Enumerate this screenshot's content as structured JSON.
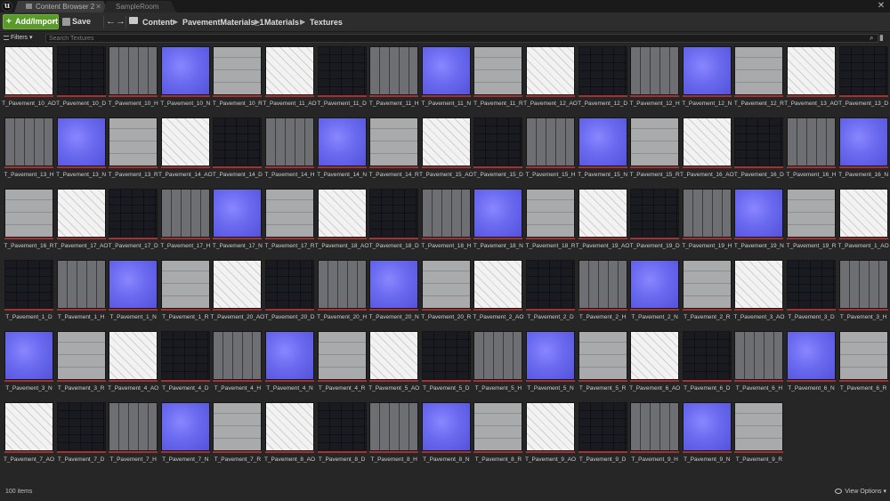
{
  "window": {
    "tabs": [
      {
        "label": "Content Browser 2",
        "active": true
      },
      {
        "label": "SampleRoom",
        "active": false
      }
    ]
  },
  "toolbar": {
    "add_import_label": "Add/Import",
    "save_all_label": "Save All",
    "breadcrumb": [
      "Content",
      "PavementMaterials_1",
      "Materials",
      "Textures"
    ]
  },
  "filterbar": {
    "filters_label": "Filters",
    "search_placeholder": "Search Textures"
  },
  "assets": [
    {
      "name": "T_Pavement_10_AO",
      "kind": "AO"
    },
    {
      "name": "T_Pavement_10_D",
      "kind": "D"
    },
    {
      "name": "T_Pavement_10_H",
      "kind": "H"
    },
    {
      "name": "T_Pavement_10_N",
      "kind": "N"
    },
    {
      "name": "T_Pavement_10_R",
      "kind": "R"
    },
    {
      "name": "T_Pavement_11_AO",
      "kind": "AO"
    },
    {
      "name": "T_Pavement_11_D",
      "kind": "D"
    },
    {
      "name": "T_Pavement_11_H",
      "kind": "H"
    },
    {
      "name": "T_Pavement_11_N",
      "kind": "N"
    },
    {
      "name": "T_Pavement_11_R",
      "kind": "R"
    },
    {
      "name": "T_Pavement_12_AO",
      "kind": "AO"
    },
    {
      "name": "T_Pavement_12_D",
      "kind": "D"
    },
    {
      "name": "T_Pavement_12_H",
      "kind": "H"
    },
    {
      "name": "T_Pavement_12_N",
      "kind": "N"
    },
    {
      "name": "T_Pavement_12_R",
      "kind": "R"
    },
    {
      "name": "T_Pavement_13_AO",
      "kind": "AO"
    },
    {
      "name": "T_Pavement_13_D",
      "kind": "D"
    },
    {
      "name": "T_Pavement_13_H",
      "kind": "H"
    },
    {
      "name": "T_Pavement_13_N",
      "kind": "N"
    },
    {
      "name": "T_Pavement_13_R",
      "kind": "R"
    },
    {
      "name": "T_Pavement_14_AO",
      "kind": "AO"
    },
    {
      "name": "T_Pavement_14_D",
      "kind": "D"
    },
    {
      "name": "T_Pavement_14_H",
      "kind": "H"
    },
    {
      "name": "T_Pavement_14_N",
      "kind": "N"
    },
    {
      "name": "T_Pavement_14_R",
      "kind": "R"
    },
    {
      "name": "T_Pavement_15_AO",
      "kind": "AO"
    },
    {
      "name": "T_Pavement_15_D",
      "kind": "D"
    },
    {
      "name": "T_Pavement_15_H",
      "kind": "H"
    },
    {
      "name": "T_Pavement_15_N",
      "kind": "N"
    },
    {
      "name": "T_Pavement_15_R",
      "kind": "R"
    },
    {
      "name": "T_Pavement_16_AO",
      "kind": "AO"
    },
    {
      "name": "T_Pavement_16_D",
      "kind": "D"
    },
    {
      "name": "T_Pavement_16_H",
      "kind": "H"
    },
    {
      "name": "T_Pavement_16_N",
      "kind": "N"
    },
    {
      "name": "T_Pavement_16_R",
      "kind": "R"
    },
    {
      "name": "T_Pavement_17_AO",
      "kind": "AO"
    },
    {
      "name": "T_Pavement_17_D",
      "kind": "D"
    },
    {
      "name": "T_Pavement_17_H",
      "kind": "H"
    },
    {
      "name": "T_Pavement_17_N",
      "kind": "N"
    },
    {
      "name": "T_Pavement_17_R",
      "kind": "R"
    },
    {
      "name": "T_Pavement_18_AO",
      "kind": "AO"
    },
    {
      "name": "T_Pavement_18_D",
      "kind": "D"
    },
    {
      "name": "T_Pavement_18_H",
      "kind": "H"
    },
    {
      "name": "T_Pavement_18_N",
      "kind": "N"
    },
    {
      "name": "T_Pavement_18_R",
      "kind": "R"
    },
    {
      "name": "T_Pavement_19_AO",
      "kind": "AO"
    },
    {
      "name": "T_Pavement_19_D",
      "kind": "D"
    },
    {
      "name": "T_Pavement_19_H",
      "kind": "H"
    },
    {
      "name": "T_Pavement_19_N",
      "kind": "N"
    },
    {
      "name": "T_Pavement_19_R",
      "kind": "R"
    },
    {
      "name": "T_Pavement_1_AO",
      "kind": "AO"
    },
    {
      "name": "T_Pavement_1_D",
      "kind": "D"
    },
    {
      "name": "T_Pavement_1_H",
      "kind": "H"
    },
    {
      "name": "T_Pavement_1_N",
      "kind": "N"
    },
    {
      "name": "T_Pavement_1_R",
      "kind": "R"
    },
    {
      "name": "T_Pavement_20_AO",
      "kind": "AO"
    },
    {
      "name": "T_Pavement_20_D",
      "kind": "D"
    },
    {
      "name": "T_Pavement_20_H",
      "kind": "H"
    },
    {
      "name": "T_Pavement_20_N",
      "kind": "N"
    },
    {
      "name": "T_Pavement_20_R",
      "kind": "R"
    },
    {
      "name": "T_Pavement_2_AO",
      "kind": "AO"
    },
    {
      "name": "T_Pavement_2_D",
      "kind": "D"
    },
    {
      "name": "T_Pavement_2_H",
      "kind": "H"
    },
    {
      "name": "T_Pavement_2_N",
      "kind": "N"
    },
    {
      "name": "T_Pavement_2_R",
      "kind": "R"
    },
    {
      "name": "T_Pavement_3_AO",
      "kind": "AO"
    },
    {
      "name": "T_Pavement_3_D",
      "kind": "D"
    },
    {
      "name": "T_Pavement_3_H",
      "kind": "H"
    },
    {
      "name": "T_Pavement_3_N",
      "kind": "N"
    },
    {
      "name": "T_Pavement_3_R",
      "kind": "R"
    },
    {
      "name": "T_Pavement_4_AO",
      "kind": "AO"
    },
    {
      "name": "T_Pavement_4_D",
      "kind": "D"
    },
    {
      "name": "T_Pavement_4_H",
      "kind": "H"
    },
    {
      "name": "T_Pavement_4_N",
      "kind": "N"
    },
    {
      "name": "T_Pavement_4_R",
      "kind": "R"
    },
    {
      "name": "T_Pavement_5_AO",
      "kind": "AO"
    },
    {
      "name": "T_Pavement_5_D",
      "kind": "D"
    },
    {
      "name": "T_Pavement_5_H",
      "kind": "H"
    },
    {
      "name": "T_Pavement_5_N",
      "kind": "N"
    },
    {
      "name": "T_Pavement_5_R",
      "kind": "R"
    },
    {
      "name": "T_Pavement_6_AO",
      "kind": "AO"
    },
    {
      "name": "T_Pavement_6_D",
      "kind": "D"
    },
    {
      "name": "T_Pavement_6_H",
      "kind": "H"
    },
    {
      "name": "T_Pavement_6_N",
      "kind": "N"
    },
    {
      "name": "T_Pavement_6_R",
      "kind": "R"
    },
    {
      "name": "T_Pavement_7_AO",
      "kind": "AO"
    },
    {
      "name": "T_Pavement_7_D",
      "kind": "D"
    },
    {
      "name": "T_Pavement_7_H",
      "kind": "H"
    },
    {
      "name": "T_Pavement_7_N",
      "kind": "N"
    },
    {
      "name": "T_Pavement_7_R",
      "kind": "R"
    },
    {
      "name": "T_Pavement_8_AO",
      "kind": "AO"
    },
    {
      "name": "T_Pavement_8_D",
      "kind": "D"
    },
    {
      "name": "T_Pavement_8_H",
      "kind": "H"
    },
    {
      "name": "T_Pavement_8_N",
      "kind": "N"
    },
    {
      "name": "T_Pavement_8_R",
      "kind": "R"
    },
    {
      "name": "T_Pavement_9_AO",
      "kind": "AO"
    },
    {
      "name": "T_Pavement_9_D",
      "kind": "D"
    },
    {
      "name": "T_Pavement_9_H",
      "kind": "H"
    },
    {
      "name": "T_Pavement_9_N",
      "kind": "N"
    },
    {
      "name": "T_Pavement_9_R",
      "kind": "R"
    }
  ],
  "status": {
    "item_count": "100 items",
    "view_options_label": "View Options"
  },
  "colors": {
    "accent_green": "#5a9a2a",
    "texture_underline": "#a53232",
    "normal_map": "#6a6af0"
  },
  "icons": {
    "engine_logo": "unreal-logo-icon",
    "back": "arrow-left-icon",
    "forward": "arrow-right-icon",
    "folder": "folder-icon",
    "search": "search-icon",
    "view": "eye-icon"
  }
}
